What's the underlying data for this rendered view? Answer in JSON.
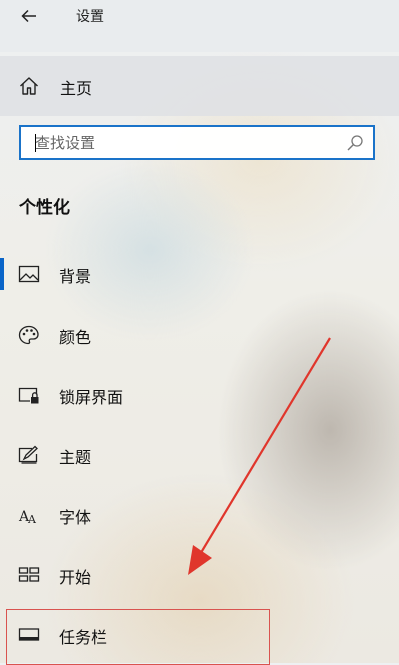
{
  "window": {
    "title": "设置"
  },
  "home": {
    "label": "主页"
  },
  "search": {
    "placeholder": "查找设置",
    "value": ""
  },
  "section": {
    "title": "个性化"
  },
  "nav_items": [
    {
      "label": "背景",
      "icon": "image-icon",
      "selected": true
    },
    {
      "label": "颜色",
      "icon": "palette-icon"
    },
    {
      "label": "锁屏界面",
      "icon": "lock-screen-icon"
    },
    {
      "label": "主题",
      "icon": "theme-icon"
    },
    {
      "label": "字体",
      "icon": "font-icon"
    },
    {
      "label": "开始",
      "icon": "start-icon"
    },
    {
      "label": "任务栏",
      "icon": "taskbar-icon"
    }
  ],
  "annotation": {
    "arrow_color": "#e0362c",
    "box_color": "#d9534f",
    "highlighted_item": "任务栏"
  },
  "colors": {
    "accent": "#0a64c8",
    "search_border": "#1a73c9"
  }
}
